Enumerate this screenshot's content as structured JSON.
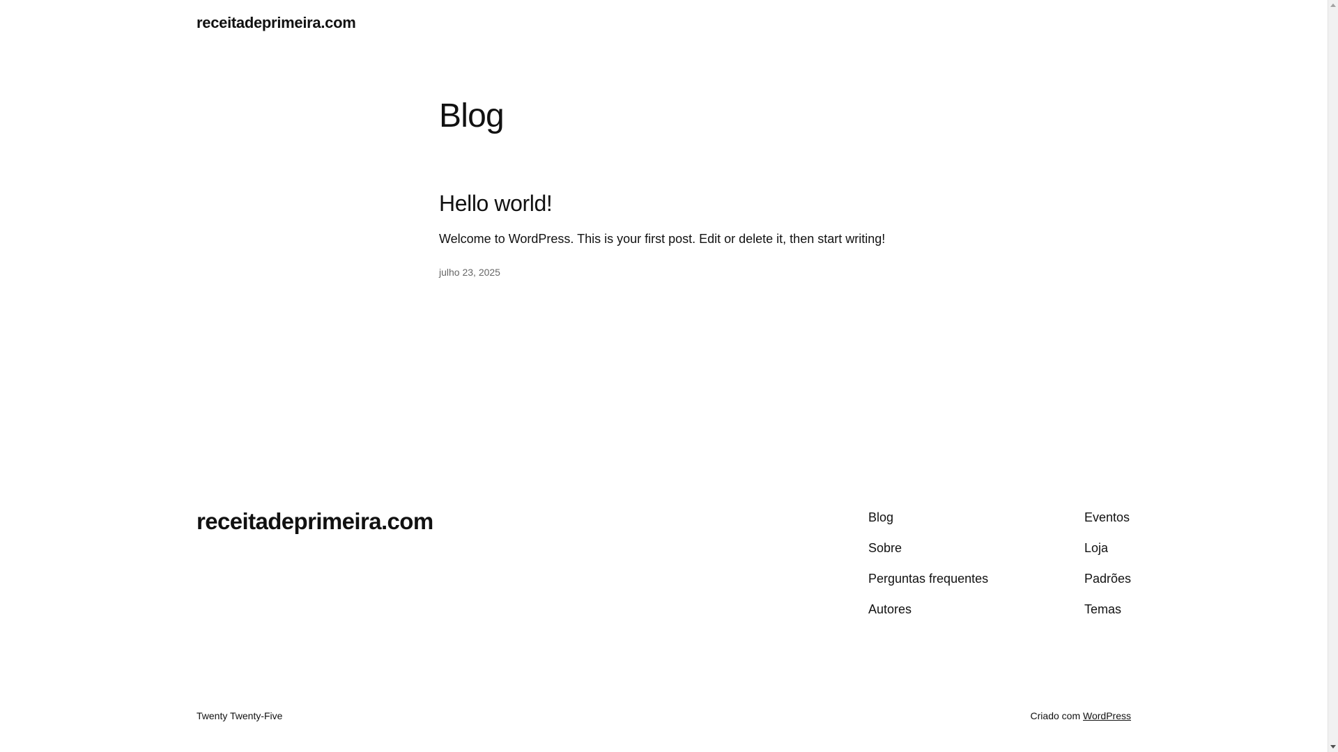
{
  "header": {
    "site_title": "receitadeprimeira.com"
  },
  "main": {
    "page_heading": "Blog",
    "post": {
      "title": "Hello world!",
      "excerpt": "Welcome to WordPress. This is your first post. Edit or delete it, then start writing!",
      "date": "julho 23, 2025"
    }
  },
  "footer": {
    "brand": "receitadeprimeira.com",
    "nav_col1": [
      "Blog",
      "Sobre",
      "Perguntas frequentes",
      "Autores"
    ],
    "nav_col2": [
      "Eventos",
      "Loja",
      "Padrões",
      "Temas"
    ],
    "theme_credit": "Twenty Twenty-Five",
    "made_with_prefix": "Criado com",
    "made_with_link": "WordPress"
  }
}
